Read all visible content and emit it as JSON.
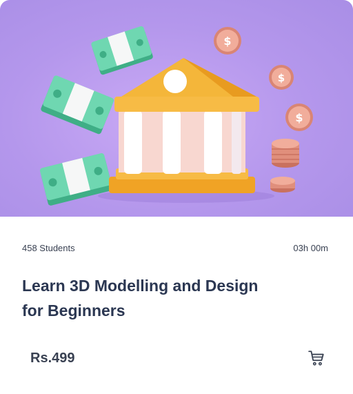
{
  "course": {
    "students": "458 Students",
    "duration": "03h 00m",
    "title_line1": "Learn 3D Modelling and Design",
    "title_line2": "for Beginners",
    "price": "Rs.499"
  },
  "icons": {
    "cart": "cart-icon",
    "hero": "bank-with-money-illustration"
  },
  "colors": {
    "hero_bg": "#b497ec",
    "title": "#2b3752",
    "text": "#394152",
    "bank_yellow": "#f4b63a",
    "cash_green": "#63cfa5",
    "coin": "#e59e8c"
  }
}
